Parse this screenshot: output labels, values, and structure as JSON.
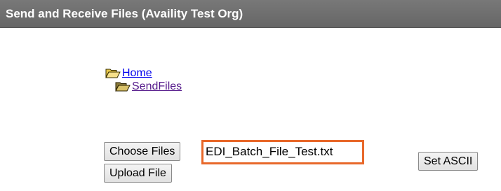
{
  "header": {
    "title": "Send and Receive Files (Availity Test Org)"
  },
  "tree": {
    "items": [
      {
        "label": "Home",
        "icon": "open-folder-icon"
      },
      {
        "label": "SendFiles",
        "icon": "open-folder-icon"
      }
    ]
  },
  "upload": {
    "choose_label": "Choose Files",
    "selected_file": "EDI_Batch_File_Test.txt",
    "upload_label": "Upload File",
    "ascii_label": "Set ASCII"
  },
  "colors": {
    "header_bg": "#6e6e6e",
    "highlight_border": "#e8682a",
    "link": "#0000ee",
    "link_visited": "#551a8b"
  }
}
